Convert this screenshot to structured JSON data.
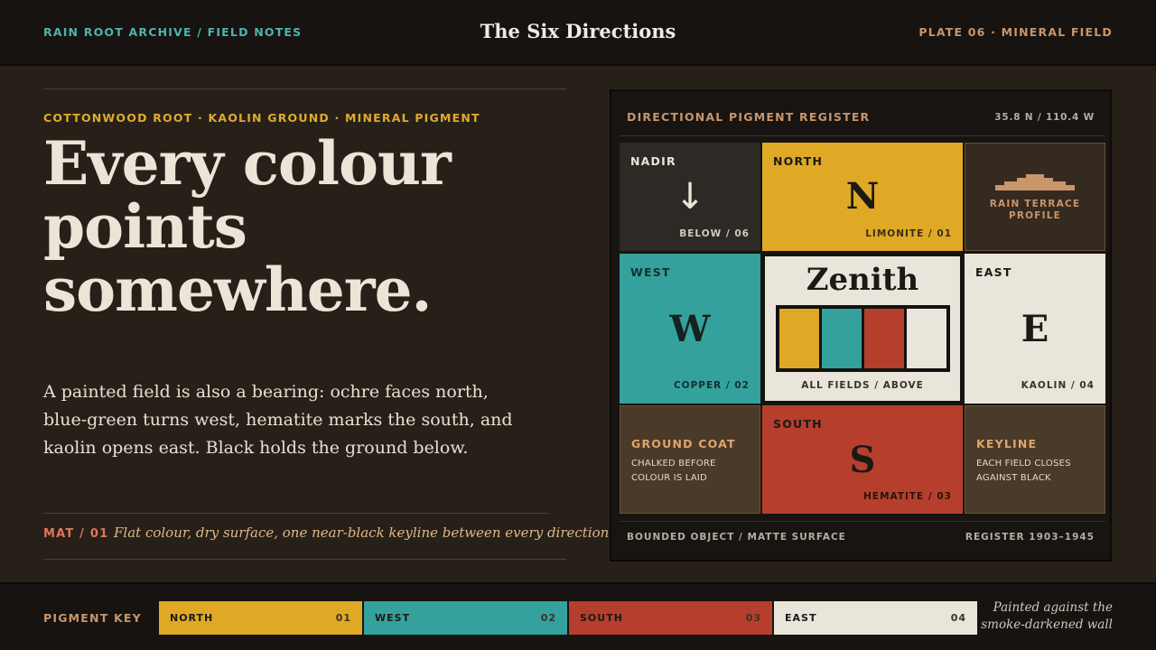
{
  "header": {
    "left": "RAIN ROOT ARCHIVE / FIELD NOTES",
    "title": "The Six Directions",
    "right": "PLATE 06 · MINERAL FIELD"
  },
  "intro": {
    "kicker": "COTTONWOOD ROOT · KAOLIN GROUND · MINERAL PIGMENT",
    "headline_lines": [
      "Every colour",
      "points",
      "somewhere."
    ],
    "body": "A painted field is also a bearing: ochre faces north, blue-green turns west, hematite marks the south, and kaolin opens east. Black holds the ground below.",
    "mat_label": "MAT / 01",
    "mat_text": "Flat colour, dry surface, one near-black keyline between every direction."
  },
  "register": {
    "title": "DIRECTIONAL PIGMENT REGISTER",
    "coords": "35.8 N / 110.4 W",
    "nadir": {
      "label": "NADIR",
      "glyph": "↓",
      "note": "BELOW / 06"
    },
    "north": {
      "label": "NORTH",
      "letter": "N",
      "note": "LIMONITE / 01"
    },
    "terrace": {
      "label": "RAIN TERRACE PROFILE"
    },
    "west": {
      "label": "WEST",
      "letter": "W",
      "note": "COPPER / 02"
    },
    "zenith": {
      "title": "Zenith",
      "note": "ALL FIELDS / ABOVE"
    },
    "east": {
      "label": "EAST",
      "letter": "E",
      "note": "KAOLIN / 04"
    },
    "ground": {
      "title": "GROUND COAT",
      "text": "CHALKED BEFORE COLOUR IS LAID"
    },
    "south": {
      "label": "SOUTH",
      "letter": "S",
      "note": "HEMATITE / 03"
    },
    "keyline": {
      "title": "KEYLINE",
      "text": "EACH FIELD CLOSES AGAINST BLACK"
    },
    "footer_left": "BOUNDED OBJECT / MATTE SURFACE",
    "footer_right": "REGISTER 1903–1945"
  },
  "footer": {
    "key_label": "PIGMENT KEY",
    "swatches": [
      {
        "name": "NORTH",
        "num": "01",
        "color": "#dfa925"
      },
      {
        "name": "WEST",
        "num": "02",
        "color": "#35a19d"
      },
      {
        "name": "SOUTH",
        "num": "03",
        "color": "#b53f2c"
      },
      {
        "name": "EAST",
        "num": "04",
        "color": "#e9e5da"
      }
    ],
    "note": "Painted against the smoke-darkened wall"
  },
  "colors": {
    "ochre": "#dfa925",
    "copper": "#35a19d",
    "hematite": "#b53f2c",
    "kaolin": "#e9e5da",
    "black": "#2d2925",
    "earth": "#4a3a2a"
  },
  "icons": {
    "nadir": "down-arrow-icon",
    "terrace": "stepped-terrace-icon"
  }
}
